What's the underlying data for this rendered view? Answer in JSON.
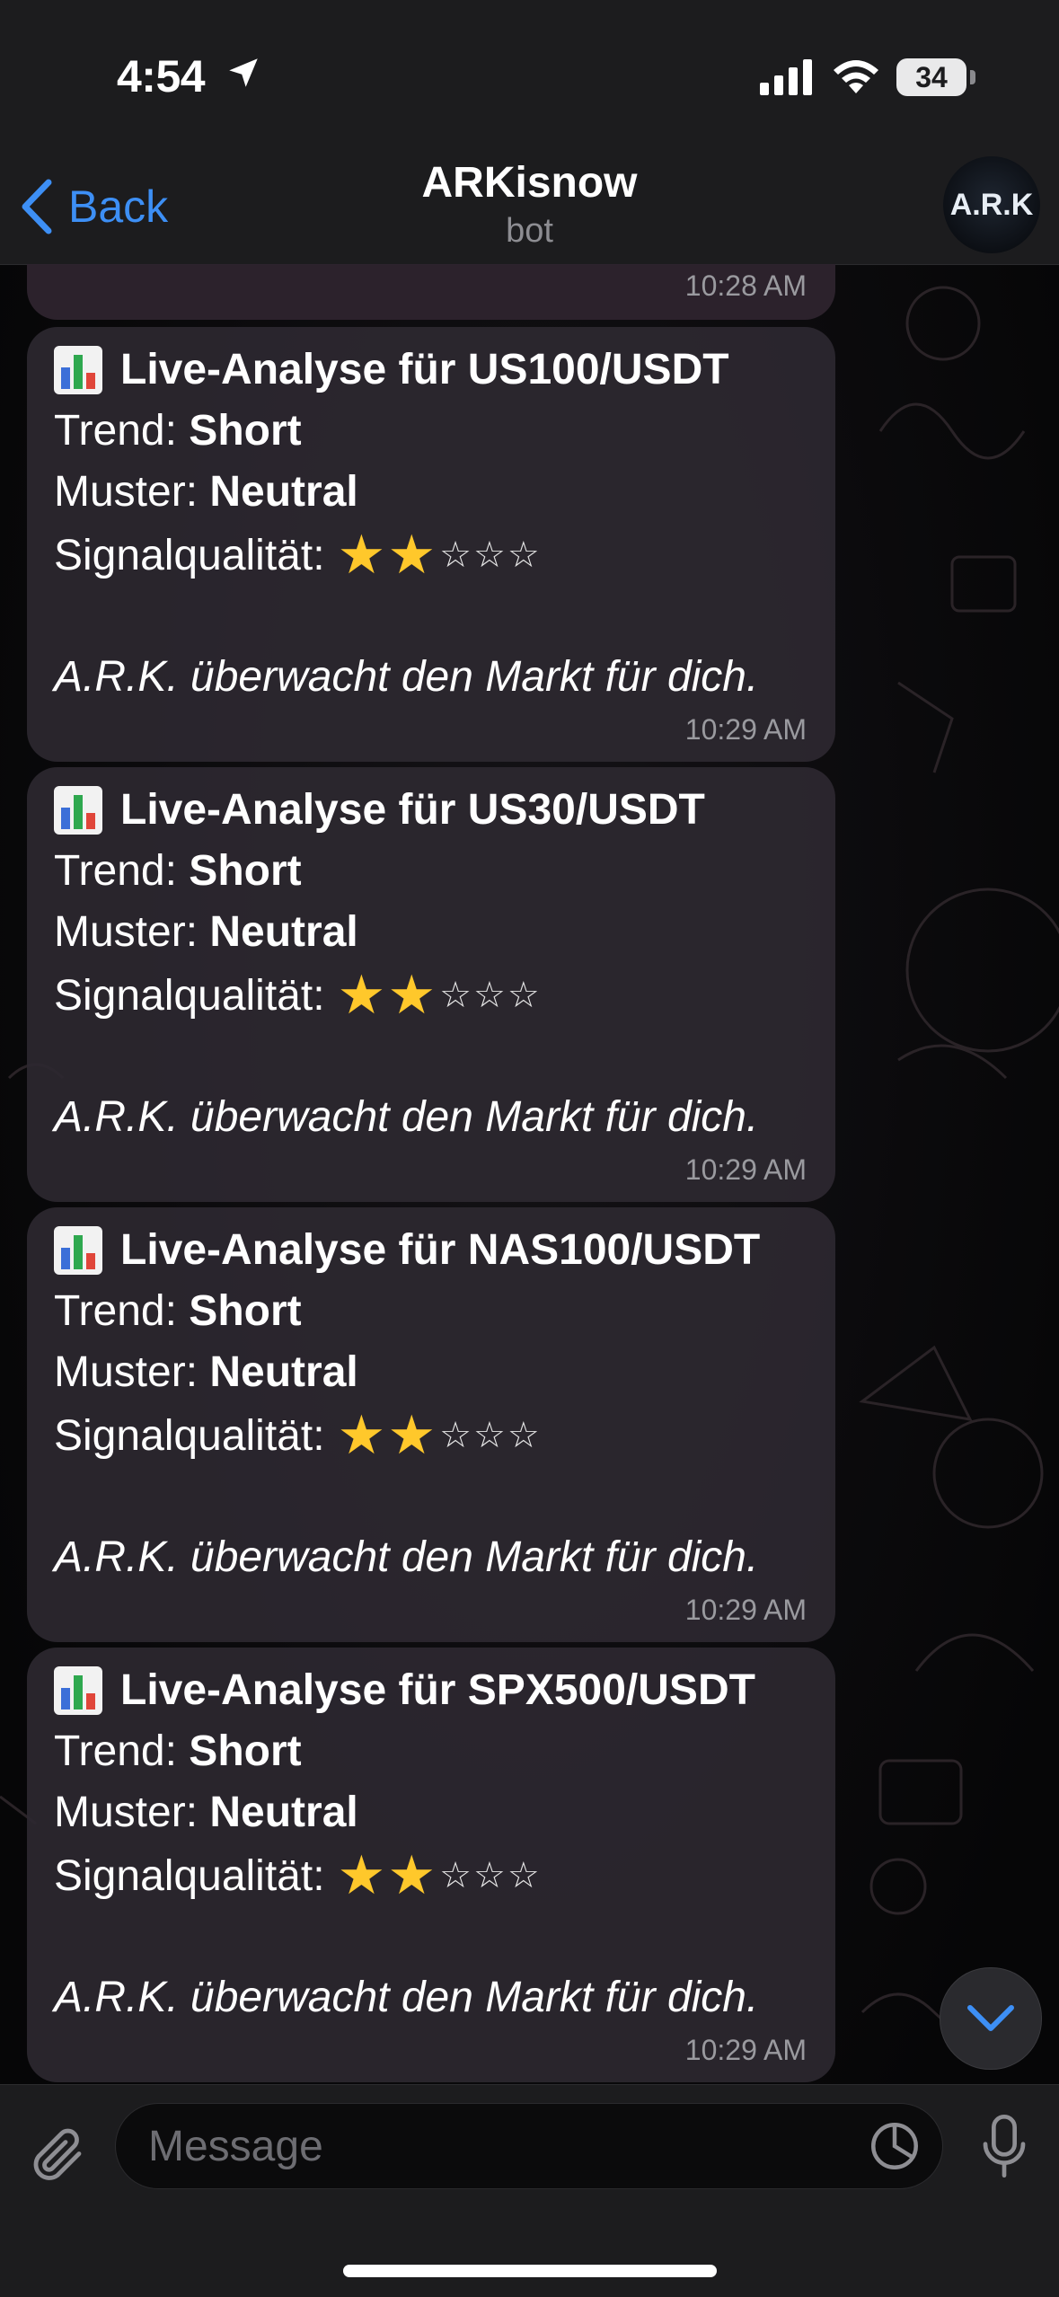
{
  "status_bar": {
    "time": "4:54",
    "battery": "34"
  },
  "header": {
    "back_label": "Back",
    "title": "ARKisnow",
    "subtitle": "bot",
    "avatar_text": "A.R.K"
  },
  "messages": [
    {
      "time": "10:28 AM"
    },
    {
      "title": "Live-Analyse für US100/USDT",
      "trend_label": "Trend:",
      "trend_value": "Short",
      "pattern_label": "Muster:",
      "pattern_value": "Neutral",
      "quality_label": "Signalqualität:",
      "footer": "A.R.K. überwacht den Markt für dich.",
      "time": "10:29 AM"
    },
    {
      "title": "Live-Analyse für US30/USDT",
      "trend_label": "Trend:",
      "trend_value": "Short",
      "pattern_label": "Muster:",
      "pattern_value": "Neutral",
      "quality_label": "Signalqualität:",
      "footer": "A.R.K. überwacht den Markt für dich.",
      "time": "10:29 AM"
    },
    {
      "title": "Live-Analyse für NAS100/USDT",
      "trend_label": "Trend:",
      "trend_value": "Short",
      "pattern_label": "Muster:",
      "pattern_value": "Neutral",
      "quality_label": "Signalqualität:",
      "footer": "A.R.K. überwacht den Markt für dich.",
      "time": "10:29 AM"
    },
    {
      "title": "Live-Analyse für SPX500/USDT",
      "trend_label": "Trend:",
      "trend_value": "Short",
      "pattern_label": "Muster:",
      "pattern_value": "Neutral",
      "quality_label": "Signalqualität:",
      "footer": "A.R.K. überwacht den Markt für dich.",
      "time": "10:29 AM"
    }
  ],
  "signal_rating": {
    "filled": 2,
    "total": 5
  },
  "composer": {
    "placeholder": "Message"
  },
  "colors": {
    "accent": "#3d8ff5",
    "bubble": "#2c2830",
    "star": "#ffc82b"
  }
}
